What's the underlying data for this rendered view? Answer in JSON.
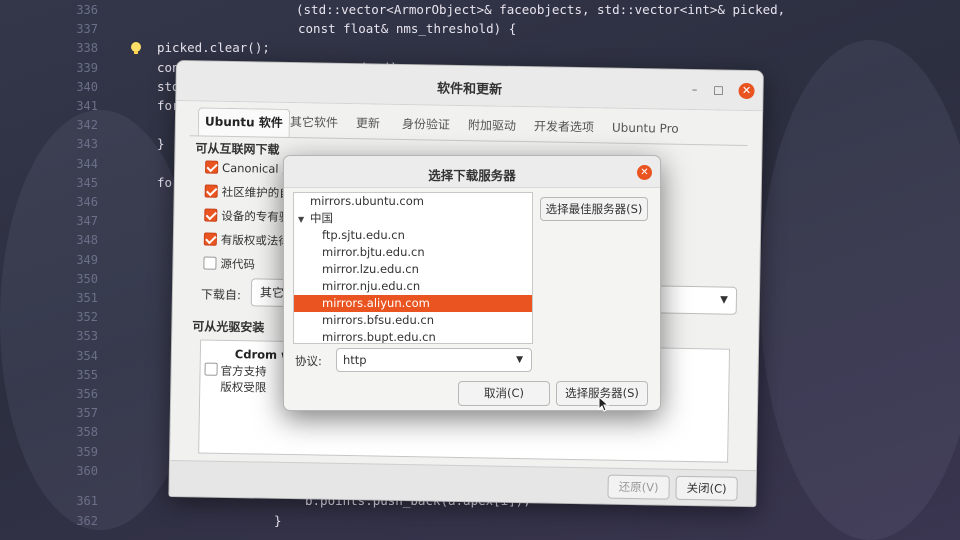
{
  "editor": {
    "lines": [
      {
        "num": "336",
        "code": "(std::vector<ArmorObject>& faceobjects, std::vector<int>& picked,"
      },
      {
        "num": "337",
        "code": "const float& nms_threshold) {"
      },
      {
        "num": "338",
        "code": "picked.clear();"
      },
      {
        "num": "339",
        "code": "const int n = faceobjects.size();"
      },
      {
        "num": "340",
        "code": "std"
      },
      {
        "num": "341",
        "code": "for"
      },
      {
        "num": "342",
        "code": ""
      },
      {
        "num": "343",
        "code": "}"
      },
      {
        "num": "344",
        "code": ""
      },
      {
        "num": "345",
        "code": "for"
      },
      {
        "num": "346",
        "code": ""
      },
      {
        "num": "347",
        "code": ""
      },
      {
        "num": "348",
        "code": ""
      },
      {
        "num": "349",
        "code": ""
      },
      {
        "num": "350",
        "code": ""
      },
      {
        "num": "351",
        "code": ""
      },
      {
        "num": "352",
        "code": ""
      },
      {
        "num": "353",
        "code": ""
      },
      {
        "num": "354",
        "code": ""
      },
      {
        "num": "355",
        "code": ""
      },
      {
        "num": "356",
        "code": ""
      },
      {
        "num": "357",
        "code": ""
      },
      {
        "num": "358",
        "code": ""
      },
      {
        "num": "359",
        "code": ""
      },
      {
        "num": "360",
        "code": ""
      },
      {
        "num": "361",
        "code": "b.points.push_back(a.apex[i]);"
      },
      {
        "num": "362",
        "code": "}"
      }
    ]
  },
  "software_window": {
    "title": "软件和更新",
    "window_controls": {
      "minimize": "–",
      "maximize": "□",
      "close": "✕"
    },
    "tabs": [
      "Ubuntu 软件",
      "其它软件",
      "更新",
      "身份验证",
      "附加驱动",
      "开发者选项",
      "Ubuntu Pro"
    ],
    "active_tab": "Ubuntu 软件",
    "downloadable_heading": "可从互联网下载",
    "options": [
      {
        "label": "Canonical 支",
        "checked": true
      },
      {
        "label": "社区维护的自",
        "checked": true
      },
      {
        "label": "设备的专有驱",
        "checked": true
      },
      {
        "label": "有版权或法律",
        "checked": true
      },
      {
        "label": "源代码",
        "checked": false
      }
    ],
    "download_from_label": "下载自:",
    "download_from_value": "其它",
    "cdrom_heading": "可从光驱安装",
    "cdrom": {
      "title": "Cdrom with",
      "line1": "官方支持",
      "line2": "版权受限",
      "checked": false
    },
    "revert_button": "还原(V)",
    "close_button": "关闭(C)"
  },
  "server_dialog": {
    "title": "选择下载服务器",
    "close_icon": "✕",
    "servers": [
      {
        "label": "mirrors.ubuntu.com",
        "indent": false,
        "selected": false,
        "group": false
      },
      {
        "label": "中国",
        "indent": false,
        "selected": false,
        "group": true
      },
      {
        "label": "ftp.sjtu.edu.cn",
        "indent": true,
        "selected": false,
        "group": false
      },
      {
        "label": "mirror.bjtu.edu.cn",
        "indent": true,
        "selected": false,
        "group": false
      },
      {
        "label": "mirror.lzu.edu.cn",
        "indent": true,
        "selected": false,
        "group": false
      },
      {
        "label": "mirror.nju.edu.cn",
        "indent": true,
        "selected": false,
        "group": false
      },
      {
        "label": "mirrors.aliyun.com",
        "indent": true,
        "selected": true,
        "group": false
      },
      {
        "label": "mirrors.bfsu.edu.cn",
        "indent": true,
        "selected": false,
        "group": false
      },
      {
        "label": "mirrors.bupt.edu.cn",
        "indent": true,
        "selected": false,
        "group": false
      }
    ],
    "best_server_button": "选择最佳服务器(S)",
    "protocol_label": "协议:",
    "protocol_value": "http",
    "cancel_button": "取消(C)",
    "choose_button": "选择服务器(S)"
  },
  "colors": {
    "accent": "#e95420",
    "window_bg": "#f1f1f0",
    "editor_bg": "#2c2f40"
  }
}
